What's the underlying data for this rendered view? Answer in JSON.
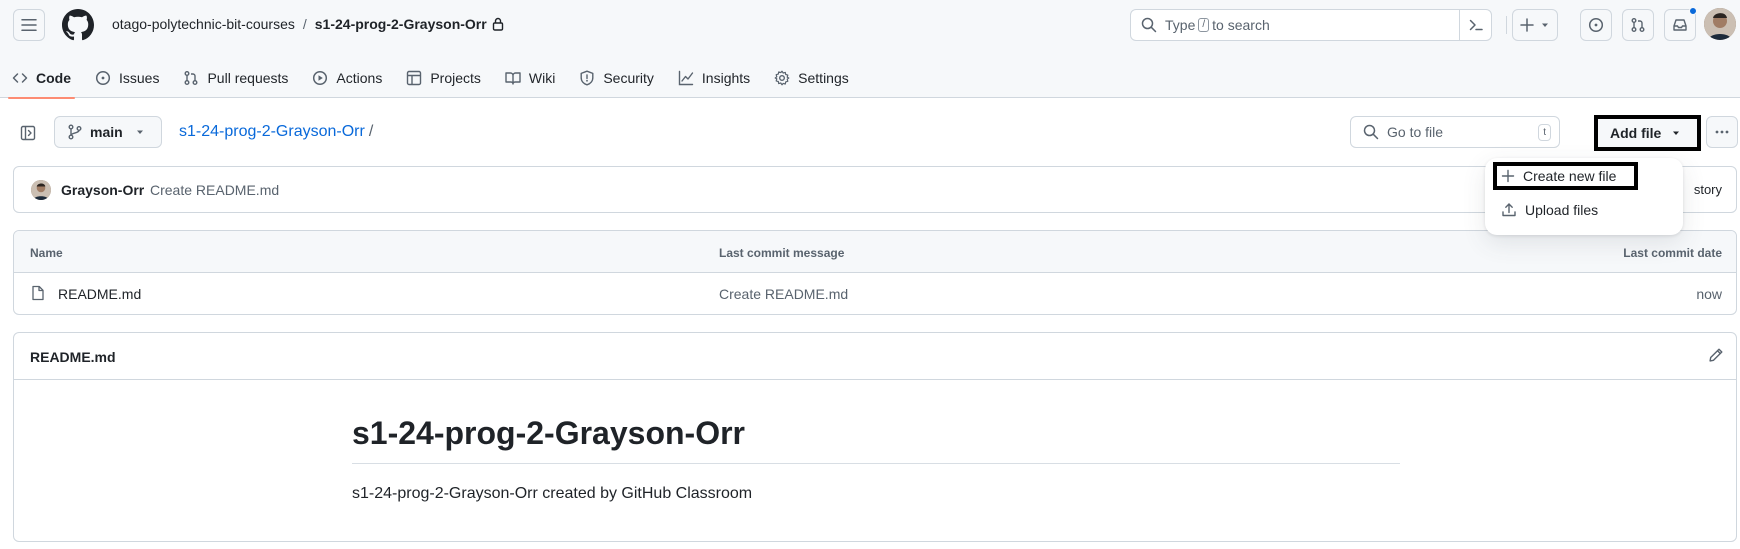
{
  "header": {
    "owner": "otago-polytechnic-bit-courses",
    "separator": "/",
    "repo": "s1-24-prog-2-Grayson-Orr",
    "search": {
      "before": "Type",
      "key": "/",
      "after": "to search"
    }
  },
  "tabs": [
    {
      "label": "Code",
      "icon": "code-icon",
      "active": true
    },
    {
      "label": "Issues",
      "icon": "issue-icon"
    },
    {
      "label": "Pull requests",
      "icon": "pull-request-icon"
    },
    {
      "label": "Actions",
      "icon": "play-icon"
    },
    {
      "label": "Projects",
      "icon": "table-icon"
    },
    {
      "label": "Wiki",
      "icon": "book-icon"
    },
    {
      "label": "Security",
      "icon": "shield-icon"
    },
    {
      "label": "Insights",
      "icon": "graph-icon"
    },
    {
      "label": "Settings",
      "icon": "gear-icon"
    }
  ],
  "toolbar": {
    "branch": "main",
    "repo_path": "s1-24-prog-2-Grayson-Orr",
    "repo_path_sep": "/",
    "goto_placeholder": "Go to file",
    "goto_key": "t",
    "add_file": "Add file"
  },
  "commit": {
    "author": "Grayson-Orr",
    "message": "Create README.md",
    "history": "story"
  },
  "files": {
    "columns": [
      "Name",
      "Last commit message",
      "Last commit date"
    ],
    "rows": [
      {
        "name": "README.md",
        "message": "Create README.md",
        "date": "now"
      }
    ]
  },
  "readme": {
    "filename": "README.md",
    "heading": "s1-24-prog-2-Grayson-Orr",
    "body": "s1-24-prog-2-Grayson-Orr created by GitHub Classroom"
  },
  "dropdown": {
    "items": [
      {
        "label": "Create new file",
        "icon": "plus-icon"
      },
      {
        "label": "Upload files",
        "icon": "upload-icon"
      }
    ]
  },
  "colors": {
    "link": "#0969da",
    "tab_underline": "#fd8c73",
    "border": "#d0d7de",
    "notification": "#0969da"
  }
}
